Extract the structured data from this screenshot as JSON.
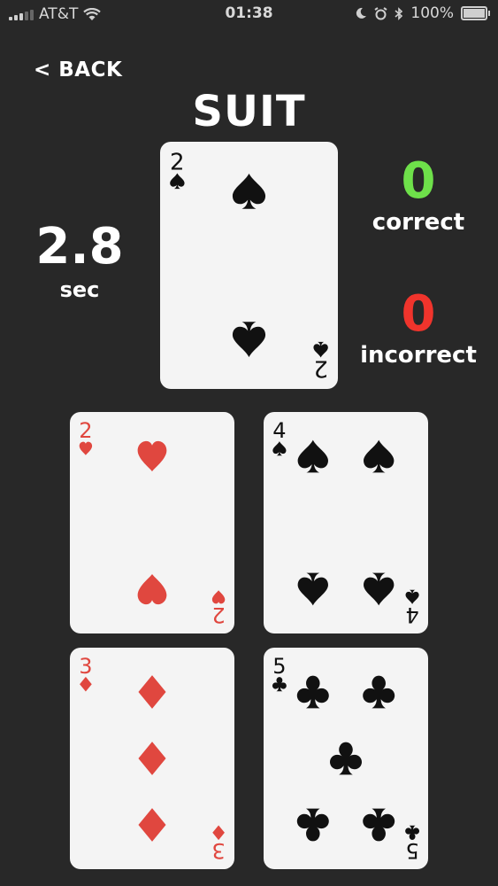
{
  "status_bar": {
    "carrier": "AT&T",
    "time": "01:38",
    "battery": "100%"
  },
  "header": {
    "back_label": "< BACK",
    "title": "SUIT"
  },
  "timer": {
    "value": "2.8",
    "unit": "sec"
  },
  "score": {
    "correct_value": "0",
    "correct_label": "correct",
    "incorrect_value": "0",
    "incorrect_label": "incorrect"
  },
  "colors": {
    "correct": "#6ee04a",
    "incorrect": "#f0342c",
    "red_suit": "#e0473f",
    "black_suit": "#111111"
  },
  "target_card": {
    "rank": "2",
    "suit": "spade"
  },
  "options": [
    {
      "rank": "2",
      "suit": "heart"
    },
    {
      "rank": "4",
      "suit": "spade"
    },
    {
      "rank": "3",
      "suit": "diamond"
    },
    {
      "rank": "5",
      "suit": "club"
    }
  ]
}
